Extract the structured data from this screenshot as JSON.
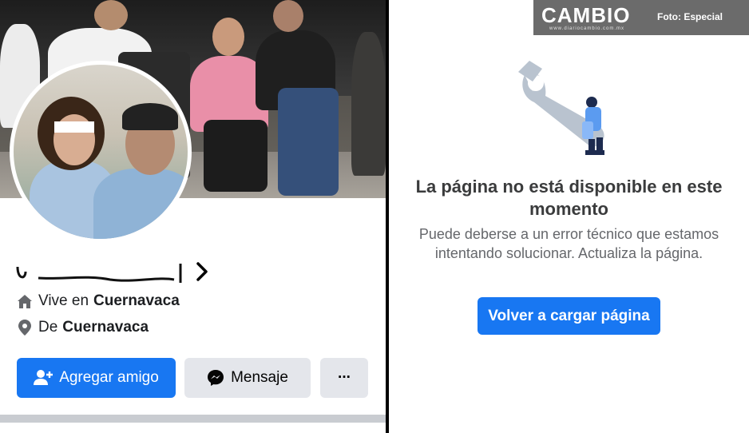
{
  "profile": {
    "lives_in_prefix": "Vive en",
    "lives_in_city": "Cuernavaca",
    "from_prefix": "De",
    "from_city": "Cuernavaca"
  },
  "actions": {
    "add_friend_label": "Agregar amigo",
    "message_label": "Mensaje",
    "more_label": "···"
  },
  "icons": {
    "home": "home-icon",
    "location": "location-pin-icon",
    "add_friend": "add-friend-icon",
    "messenger": "messenger-icon",
    "chevron": "chevron-right-icon",
    "wrench": "wrench-illustration"
  },
  "watermark": {
    "logo": "CAMBIO",
    "url": "www.diariocambio.com.mx",
    "credit": "Foto: Especial"
  },
  "error": {
    "title": "La página no está disponible en este momento",
    "body": "Puede deberse a un error técnico que estamos intentando solucionar. Actualiza la página.",
    "reload_label": "Volver a cargar página"
  },
  "colors": {
    "primary": "#1877f2",
    "secondary_button": "#e4e6eb",
    "error_title": "#3a3b3c",
    "error_body": "#65676b"
  }
}
